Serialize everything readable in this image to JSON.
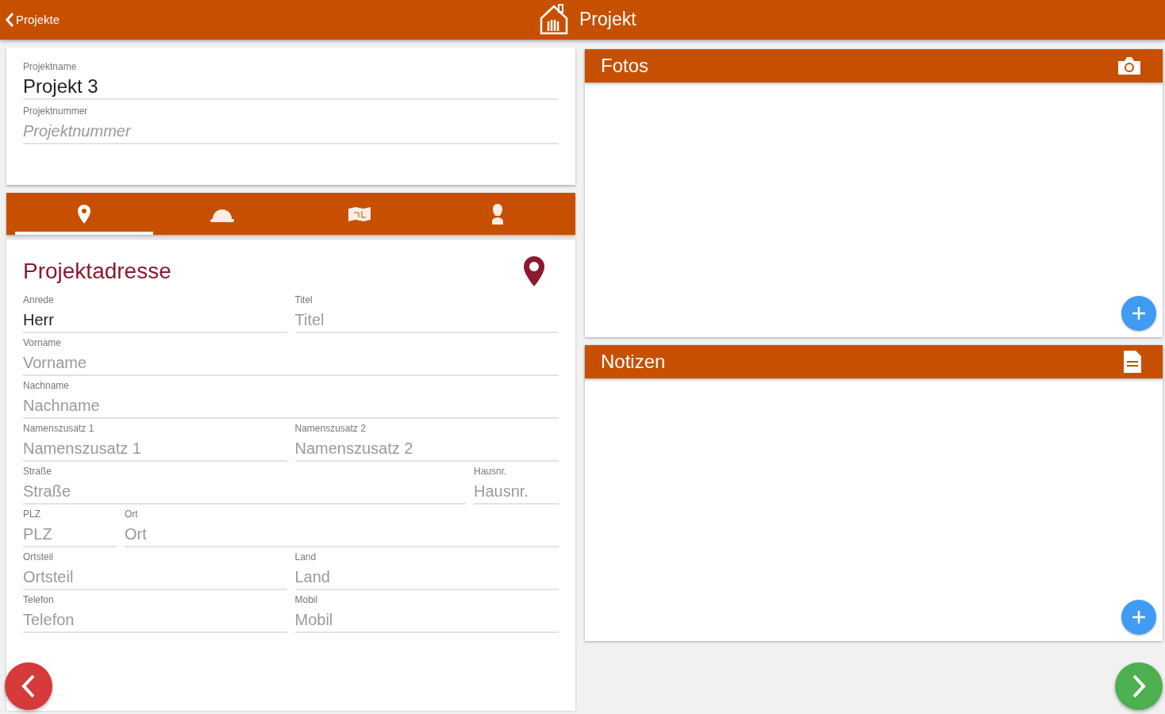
{
  "header": {
    "back_label": "Projekte",
    "title": "Projekt"
  },
  "project": {
    "fields": [
      {
        "label": "Projektname",
        "value": "Projekt 3"
      },
      {
        "label": "Projektnummer",
        "placeholder": "Projektnummer"
      }
    ]
  },
  "tabs": [
    {
      "selected": true
    },
    {
      "selected": false
    },
    {
      "selected": false
    },
    {
      "selected": false
    }
  ],
  "address": {
    "title": "Projektadresse",
    "rows": [
      [
        {
          "label": "Anrede",
          "value": "Herr"
        },
        {
          "label": "Titel",
          "placeholder": "Titel"
        }
      ],
      [
        {
          "label": "Vorname",
          "placeholder": "Vorname"
        }
      ],
      [
        {
          "label": "Nachname",
          "placeholder": "Nachname"
        }
      ],
      [
        {
          "label": "Namenszusatz 1",
          "placeholder": "Namenszusatz 1"
        },
        {
          "label": "Namenszusatz 2",
          "placeholder": "Namenszusatz 2"
        }
      ],
      [
        {
          "label": "Straße",
          "placeholder": "Straße"
        },
        {
          "label": "Hausnr.",
          "placeholder": "Hausnr."
        }
      ],
      [
        {
          "label": "PLZ",
          "placeholder": "PLZ"
        },
        {
          "label": "Ort",
          "placeholder": "Ort"
        }
      ],
      [
        {
          "label": "Ortsteil",
          "placeholder": "Ortsteil"
        },
        {
          "label": "Land",
          "placeholder": "Land"
        }
      ],
      [
        {
          "label": "Telefon",
          "placeholder": "Telefon"
        },
        {
          "label": "Mobil",
          "placeholder": "Mobil"
        }
      ]
    ]
  },
  "panels": [
    {
      "kind": "photos",
      "title": "Fotos"
    },
    {
      "kind": "notes",
      "title": "Notizen"
    }
  ]
}
